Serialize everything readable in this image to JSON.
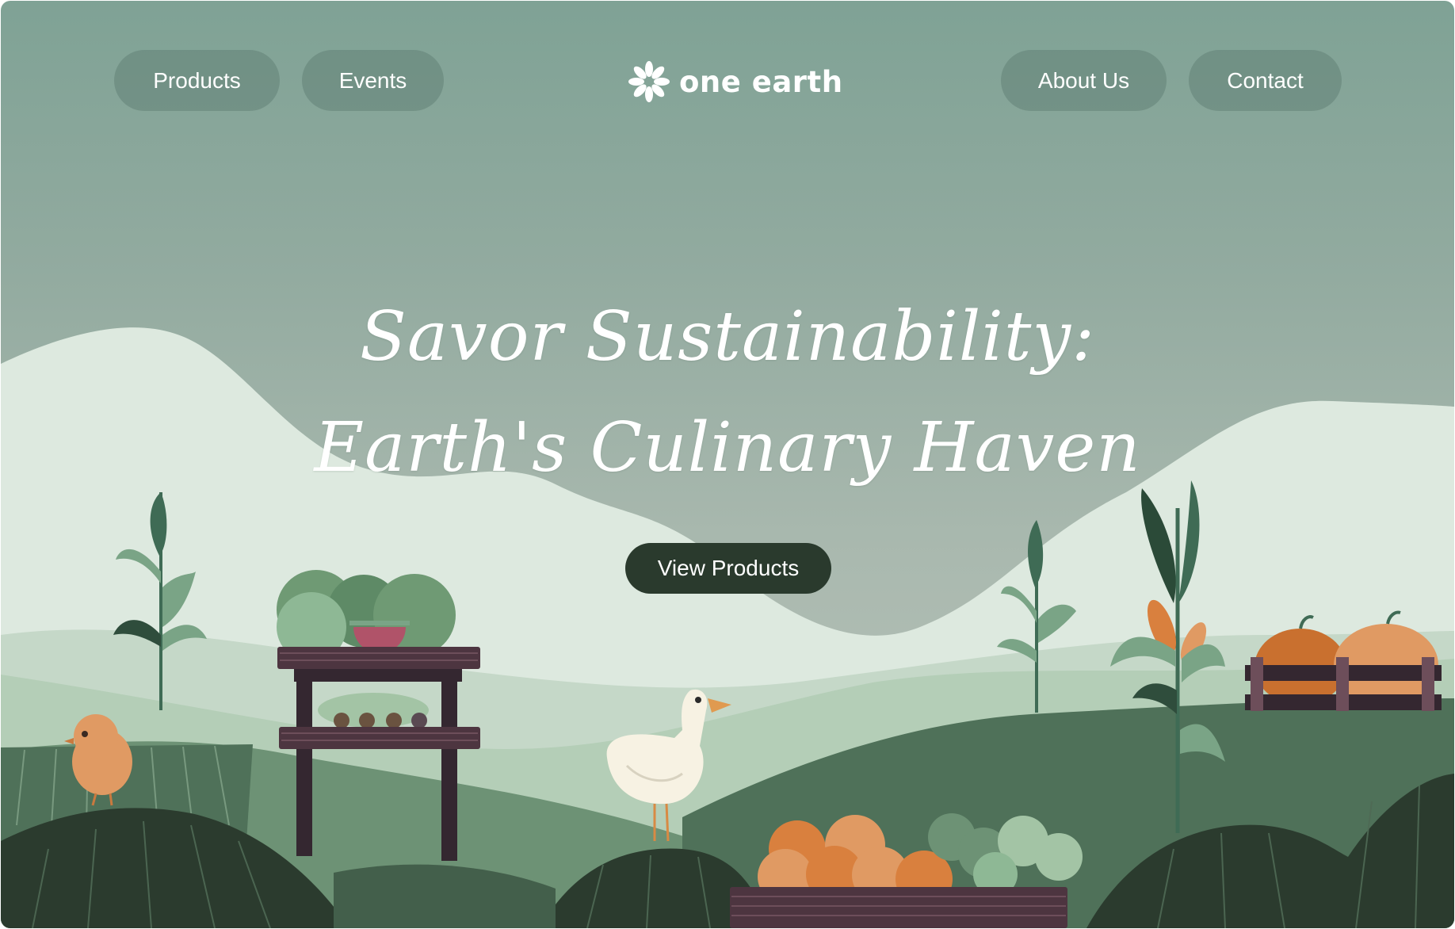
{
  "nav": {
    "products": "Products",
    "events": "Events",
    "about": "About Us",
    "contact": "Contact"
  },
  "logo": {
    "text": "one earth",
    "icon": "flower-icon"
  },
  "hero": {
    "line1": "Savor Sustainability:",
    "line2": "Earth's Culinary Haven",
    "cta_label": "View Products"
  },
  "colors": {
    "sky": "#7fa295",
    "cta": "#2a3a2d",
    "hill_dark": "#2b3b2e",
    "hill_mid": "#4f7159"
  }
}
